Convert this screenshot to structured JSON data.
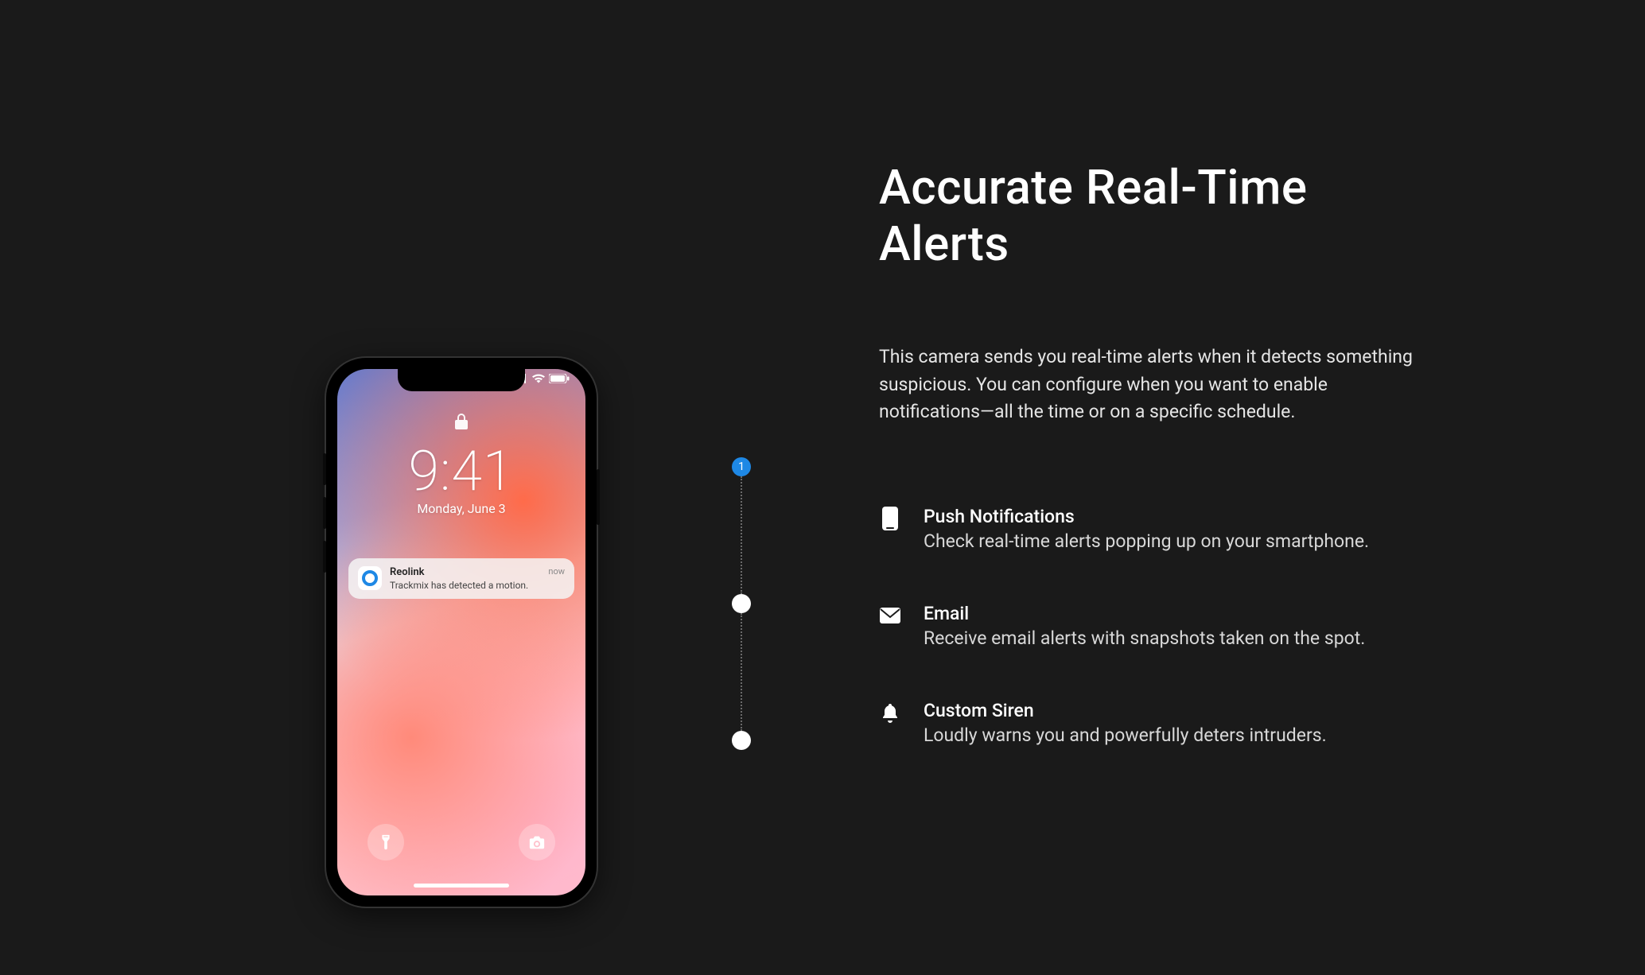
{
  "heading": "Accurate Real-Time Alerts",
  "description": "This camera sends you real-time alerts when it detects something suspicious. You can configure when you want to enable notifications—all the time or on a specific schedule.",
  "features": [
    {
      "title": "Push Notifications",
      "desc": "Check real-time alerts popping up on your smartphone."
    },
    {
      "title": "Email",
      "desc": "Receive email alerts with snapshots taken on the spot."
    },
    {
      "title": "Custom Siren",
      "desc": "Loudly warns you and powerfully deters intruders."
    }
  ],
  "stepper": {
    "active_label": "1"
  },
  "phone_lockscreen": {
    "time": "9:41",
    "date": "Monday, June 3",
    "notification": {
      "app": "Reolink",
      "message": "Trackmix has detected a motion.",
      "when": "now"
    }
  },
  "colors": {
    "accent": "#1e88e5"
  }
}
